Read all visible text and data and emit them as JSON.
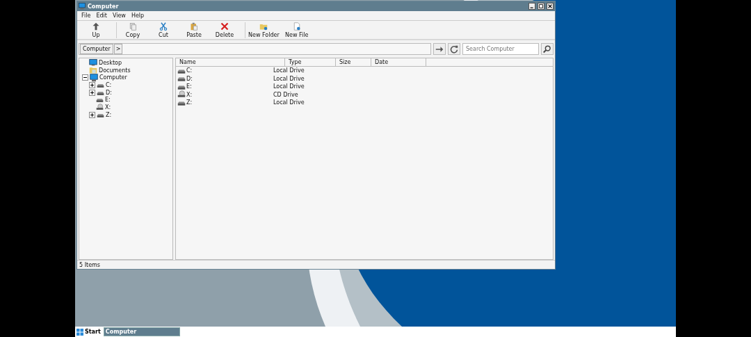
{
  "window": {
    "title": "Computer"
  },
  "menu": [
    "File",
    "Edit",
    "View",
    "Help"
  ],
  "toolbar": [
    [
      {
        "label": "Up",
        "kind": "up"
      }
    ],
    [
      {
        "label": "Copy",
        "kind": "copy"
      },
      {
        "label": "Cut",
        "kind": "cut"
      },
      {
        "label": "Paste",
        "kind": "paste"
      },
      {
        "label": "Delete",
        "kind": "delete"
      }
    ],
    [
      {
        "label": "New Folder",
        "kind": "newfolder"
      },
      {
        "label": "New File",
        "kind": "newfile"
      }
    ]
  ],
  "address": {
    "crumbs": [
      "Computer"
    ],
    "separator": ">"
  },
  "search": {
    "placeholder": "Search Computer"
  },
  "tree": [
    {
      "label": "Desktop",
      "kind": "desktop"
    },
    {
      "label": "Documents",
      "kind": "documents"
    },
    {
      "label": "Computer",
      "kind": "computer",
      "expanded": true,
      "children": [
        {
          "label": "C:",
          "kind": "drive",
          "expanded": false
        },
        {
          "label": "D:",
          "kind": "drive",
          "expanded": false
        },
        {
          "label": "E:",
          "kind": "drive"
        },
        {
          "label": "X:",
          "kind": "cd"
        },
        {
          "label": "Z:",
          "kind": "drive",
          "expanded": false
        }
      ]
    }
  ],
  "table": {
    "columns": [
      "Name",
      "Type",
      "Size",
      "Date"
    ],
    "rows": [
      {
        "name": "C:",
        "type": "Local Drive",
        "kind": "drive"
      },
      {
        "name": "D:",
        "type": "Local Drive",
        "kind": "drive"
      },
      {
        "name": "E:",
        "type": "Local Drive",
        "kind": "drive"
      },
      {
        "name": "X:",
        "type": "CD Drive",
        "kind": "cd"
      },
      {
        "name": "Z:",
        "type": "Local Drive",
        "kind": "drive"
      }
    ]
  },
  "status_bar": "5 Items",
  "taskbar": {
    "start": "Start",
    "tasks": [
      "Computer"
    ]
  }
}
